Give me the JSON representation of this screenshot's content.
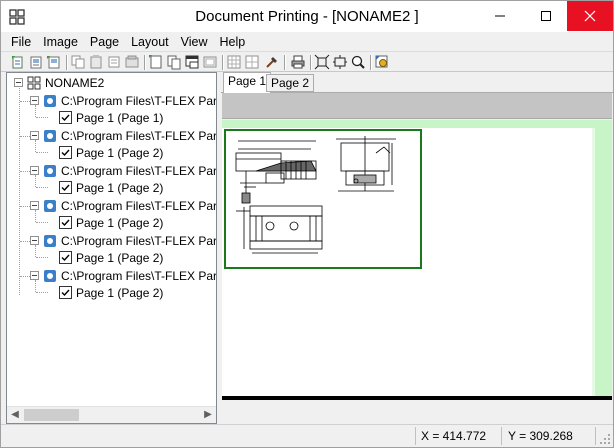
{
  "window": {
    "title": "Document Printing - [NONAME2 ]"
  },
  "menu": [
    "File",
    "Image",
    "Page",
    "Layout",
    "View",
    "Help"
  ],
  "toolbar": {
    "icons": [
      "new-page-icon",
      "add-page-icon",
      "remove-page-icon",
      "copy-icon",
      "paste-icon",
      "cut-icon",
      "delete-icon",
      "new-doc-icon",
      "duplicate-icon",
      "window-icon",
      "frame-icon",
      "grid-icon",
      "grid-alt-icon",
      "properties-icon",
      "print-icon",
      "fit-page-icon",
      "fit-width-icon",
      "zoom-icon",
      "settings-icon"
    ]
  },
  "tree": {
    "root": "NONAME2",
    "items": [
      {
        "path": "C:\\Program Files\\T-FLEX Parametric",
        "page": "Page 1 (Page 1)"
      },
      {
        "path": "C:\\Program Files\\T-FLEX Parametric",
        "page": "Page 1 (Page 2)"
      },
      {
        "path": "C:\\Program Files\\T-FLEX Parametric",
        "page": "Page 1 (Page 2)"
      },
      {
        "path": "C:\\Program Files\\T-FLEX Parametric",
        "page": "Page 1 (Page 2)"
      },
      {
        "path": "C:\\Program Files\\T-FLEX Parametric",
        "page": "Page 1 (Page 2)"
      },
      {
        "path": "C:\\Program Files\\T-FLEX Parametric",
        "page": "Page 1 (Page 2)"
      }
    ]
  },
  "tabs": [
    "Page 1",
    "Page 2"
  ],
  "status": {
    "x": "X = 414.772",
    "y": "Y = 309.268"
  },
  "colors": {
    "page_border": "#1a7a1a",
    "margin_green": "#c8f5c8",
    "close_button": "#e81123"
  }
}
